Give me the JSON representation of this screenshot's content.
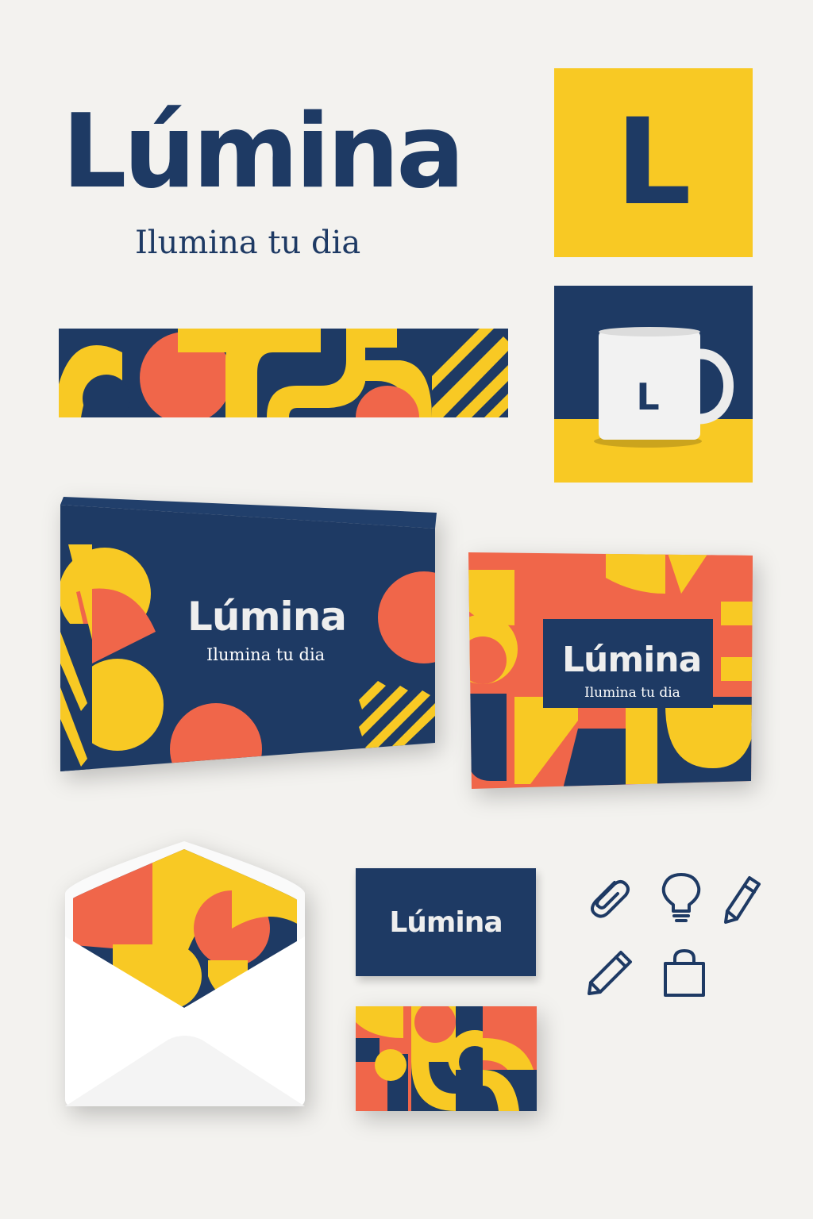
{
  "brand": {
    "name": "Lúmina",
    "tagline": "Ilumina tu dia",
    "monogram": "L"
  },
  "mug": {
    "monogram": "L"
  },
  "box_large": {
    "name": "Lúmina",
    "tagline": "Ilumina tu dia"
  },
  "box_small": {
    "name": "Lúmina",
    "tagline": "Ilumina tu dia"
  },
  "business_card": {
    "name": "Lúmina"
  },
  "icons": [
    "paperclip-icon",
    "lightbulb-icon",
    "eraser-pencil-icon",
    "pencil-icon",
    "shopping-bag-icon"
  ],
  "colors": {
    "navy": "#1e3a64",
    "yellow": "#f8c924",
    "coral": "#f0664a",
    "background": "#f3f2ef"
  }
}
